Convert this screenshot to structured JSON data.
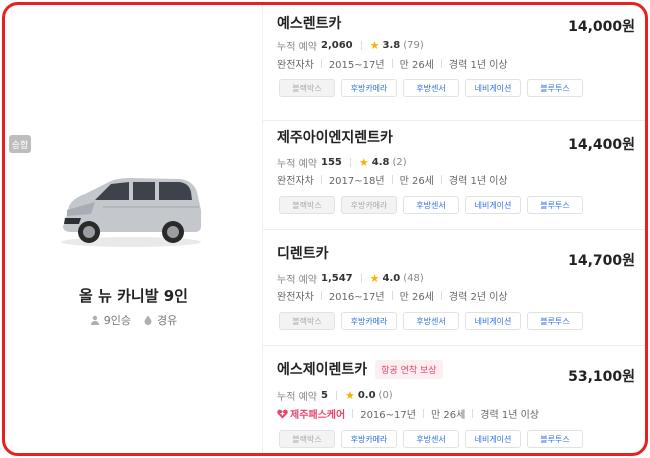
{
  "car": {
    "tag": "승합",
    "name": "올 뉴 카니발 9인",
    "seats": "9인승",
    "fuel": "경유",
    "image_icon": "car-image"
  },
  "companies": [
    {
      "name": "예스렌트카",
      "price": "14,000원",
      "reservations_label": "누적 예약",
      "reservations": "2,060",
      "rating": "3.8",
      "reviews": "(79)",
      "insurance": "완전자차",
      "years": "2015~17년",
      "min_age": "만 26세",
      "experience": "경력 1년 이상",
      "options": [
        {
          "label": "블랙박스",
          "on": false
        },
        {
          "label": "후방카메라",
          "on": true
        },
        {
          "label": "후방센서",
          "on": true
        },
        {
          "label": "네비게이션",
          "on": true
        },
        {
          "label": "블루투스",
          "on": true
        }
      ]
    },
    {
      "name": "제주아이엔지렌트카",
      "price": "14,400원",
      "reservations_label": "누적 예약",
      "reservations": "155",
      "rating": "4.8",
      "reviews": "(2)",
      "insurance": "완전자차",
      "years": "2017~18년",
      "min_age": "만 26세",
      "experience": "경력 1년 이상",
      "options": [
        {
          "label": "블랙박스",
          "on": false
        },
        {
          "label": "후방카메라",
          "on": false
        },
        {
          "label": "후방센서",
          "on": true
        },
        {
          "label": "네비게이션",
          "on": true
        },
        {
          "label": "블루투스",
          "on": true
        }
      ]
    },
    {
      "name": "디렌트카",
      "price": "14,700원",
      "reservations_label": "누적 예약",
      "reservations": "1,547",
      "rating": "4.0",
      "reviews": "(48)",
      "insurance": "완전자차",
      "years": "2016~17년",
      "min_age": "만 26세",
      "experience": "경력 2년 이상",
      "options": [
        {
          "label": "블랙박스",
          "on": false
        },
        {
          "label": "후방카메라",
          "on": true
        },
        {
          "label": "후방센서",
          "on": true
        },
        {
          "label": "네비게이션",
          "on": true
        },
        {
          "label": "블루투스",
          "on": true
        }
      ]
    },
    {
      "name": "에스제이렌트카",
      "badge": "항공 연착 보상",
      "price": "53,100원",
      "reservations_label": "누적 예약",
      "reservations": "5",
      "rating": "0.0",
      "reviews": "(0)",
      "insurance": "제주패스케어",
      "years": "2016~17년",
      "min_age": "만 26세",
      "experience": "경력 1년 이상",
      "options": [
        {
          "label": "블랙박스",
          "on": false
        },
        {
          "label": "후방카메라",
          "on": true
        },
        {
          "label": "후방센서",
          "on": true
        },
        {
          "label": "네비게이션",
          "on": true
        },
        {
          "label": "블루투스",
          "on": true
        }
      ]
    }
  ],
  "colors": {
    "frame": "#e8211f",
    "option_on": "#2f6fe4",
    "star": "#f6b400",
    "promo": "#e8456b"
  }
}
